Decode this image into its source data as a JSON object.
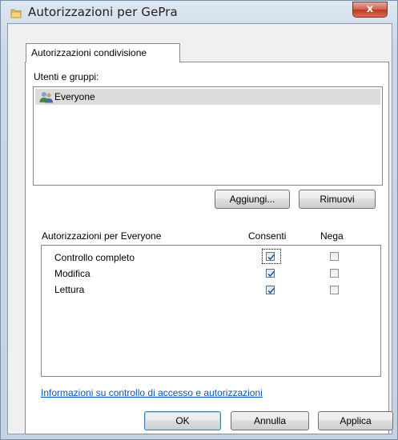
{
  "window": {
    "title": "Autorizzazioni per GePra",
    "close_label": "x"
  },
  "tabs": [
    {
      "label": "Autorizzazioni condivisione"
    }
  ],
  "users": {
    "label": "Utenti e gruppi:",
    "items": [
      {
        "name": "Everyone",
        "icon": "users-group-icon"
      }
    ],
    "add_label": "Aggiungi...",
    "remove_label": "Rimuovi"
  },
  "permissions": {
    "label": "Autorizzazioni per Everyone",
    "allow_header": "Consenti",
    "deny_header": "Nega",
    "rows": [
      {
        "name": "Controllo completo",
        "allow": true,
        "deny": false
      },
      {
        "name": "Modifica",
        "allow": true,
        "deny": false
      },
      {
        "name": "Lettura",
        "allow": true,
        "deny": false
      }
    ]
  },
  "link_text": "Informazioni su controllo di accesso e autorizzazioni",
  "footer": {
    "ok_label": "OK",
    "cancel_label": "Annulla",
    "apply_label": "Applica"
  },
  "colors": {
    "link": "#0055cc",
    "close_button": "#c9452f",
    "check_mark": "#2a5b9d"
  }
}
